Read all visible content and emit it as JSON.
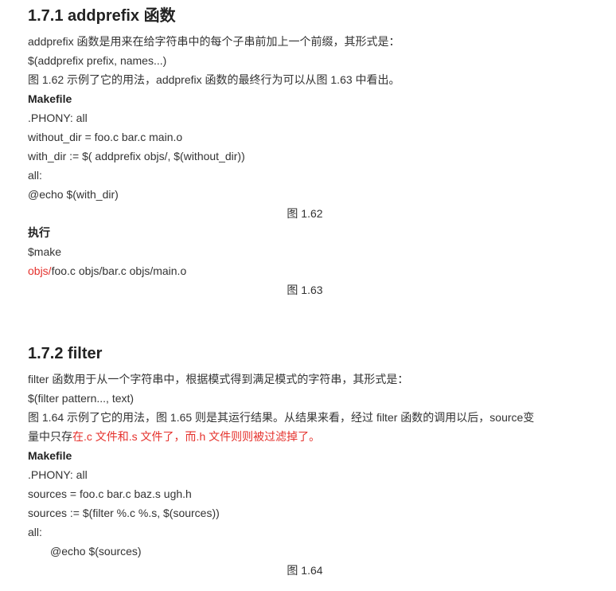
{
  "section1": {
    "heading": "1.7.1 addprefix 函数",
    "intro": "addprefix 函数是用来在给字符串中的每个子串前加上一个前缀，其形式是：",
    "syntax": "$(addprefix prefix, names...)",
    "desc": "图 1.62 示例了它的用法，addprefix 函数的最终行为可以从图 1.63 中看出。",
    "makefile_label": "Makefile",
    "code": [
      ".PHONY: all",
      "without_dir = foo.c bar.c main.o",
      "with_dir := $( addprefix objs/, $(without_dir))",
      "all:",
      "@echo $(with_dir)"
    ],
    "caption1": "图 1.62",
    "exec_label": "执行",
    "exec_cmd": "$make",
    "output_red": "objs/",
    "output_rest": "foo.c objs/bar.c objs/main.o",
    "caption2": "图 1.63"
  },
  "section2": {
    "heading": "1.7.2 filter",
    "intro": "filter 函数用于从一个字符串中，根据模式得到满足模式的字符串，其形式是：",
    "syntax": "$(filter pattern..., text)",
    "desc_line1": "图 1.64 示例了它的用法，图 1.65 则是其运行结果。从结果来看，经过 filter 函数的调用以后，source变",
    "desc_line2_plain": "量中只存",
    "desc_line2_red": "在.c 文件和.s 文件了，而.h 文件则则被过滤掉了。",
    "makefile_label": "Makefile",
    "code": [
      ".PHONY: all",
      "sources = foo.c bar.c baz.s ugh.h",
      "sources := $(filter %.c %.s, $(sources))",
      "all:"
    ],
    "code_indented": "@echo $(sources)",
    "caption": "图 1.64"
  }
}
